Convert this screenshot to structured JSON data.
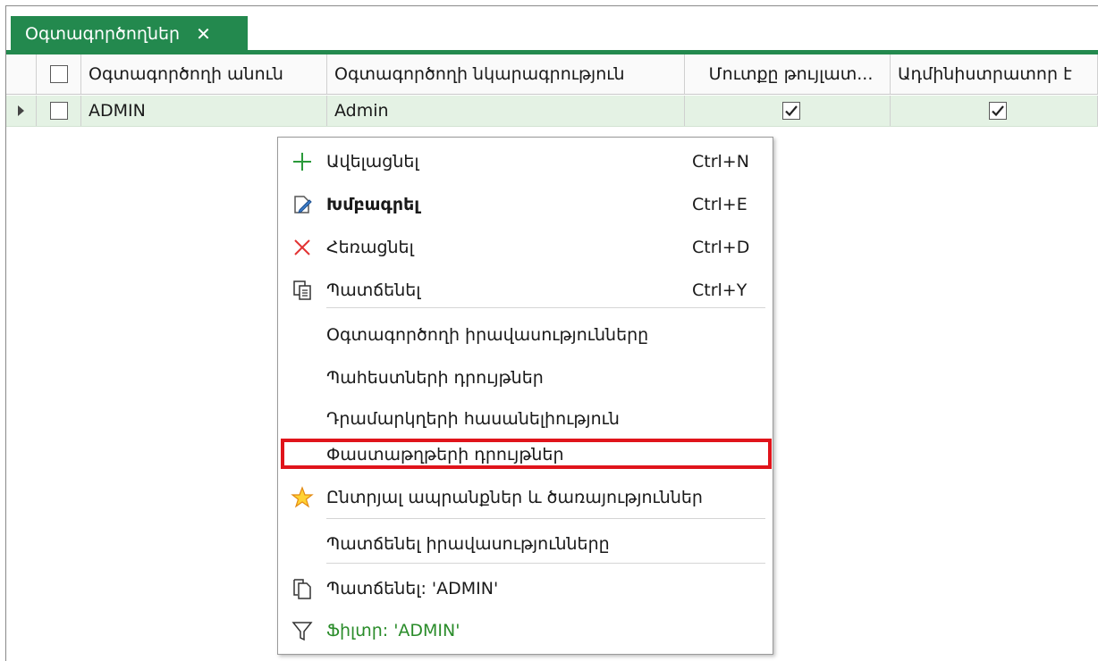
{
  "tab": {
    "title": "Օգտագործողներ",
    "close_glyph": "✕"
  },
  "grid": {
    "columns": [
      "Օգտագործողի անուն",
      "Օգտագործողի նկարագրություն",
      "Մուտքը թույլատ...",
      "Ադմինիստրատոր է"
    ],
    "rows": [
      {
        "name": "ADMIN",
        "description": "Admin",
        "login_allowed": true,
        "is_admin": true
      }
    ]
  },
  "context_menu": {
    "items": [
      {
        "label": "Ավելացնել",
        "shortcut": "Ctrl+N",
        "icon": "plus-icon"
      },
      {
        "label": "Խմբագրել",
        "shortcut": "Ctrl+E",
        "icon": "edit-icon"
      },
      {
        "label": "Հեռացնել",
        "shortcut": "Ctrl+D",
        "icon": "delete-icon"
      },
      {
        "label": "Պատճենել",
        "shortcut": "Ctrl+Y",
        "icon": "copy-icon"
      },
      {
        "label": "Օգտագործողի իրավասությունները"
      },
      {
        "label": "Պահեստների դրույթներ"
      },
      {
        "label": "Դրամարկղերի հասանելիություն"
      },
      {
        "label": "Փաստաթղթերի դրույթներ"
      },
      {
        "label": "Ընտրյալ ապրանքներ և ծառայություններ",
        "icon": "star-icon"
      },
      {
        "label": "Պատճենել իրավասությունները"
      },
      {
        "label": "Պատճենել: 'ADMIN'",
        "icon": "copy-value-icon"
      },
      {
        "label": "Ֆիլտր: 'ADMIN'",
        "icon": "filter-icon"
      }
    ]
  },
  "colors": {
    "accent_green": "#23894e",
    "highlight_red": "#e0141b",
    "row_selected": "#e4f2e4"
  }
}
